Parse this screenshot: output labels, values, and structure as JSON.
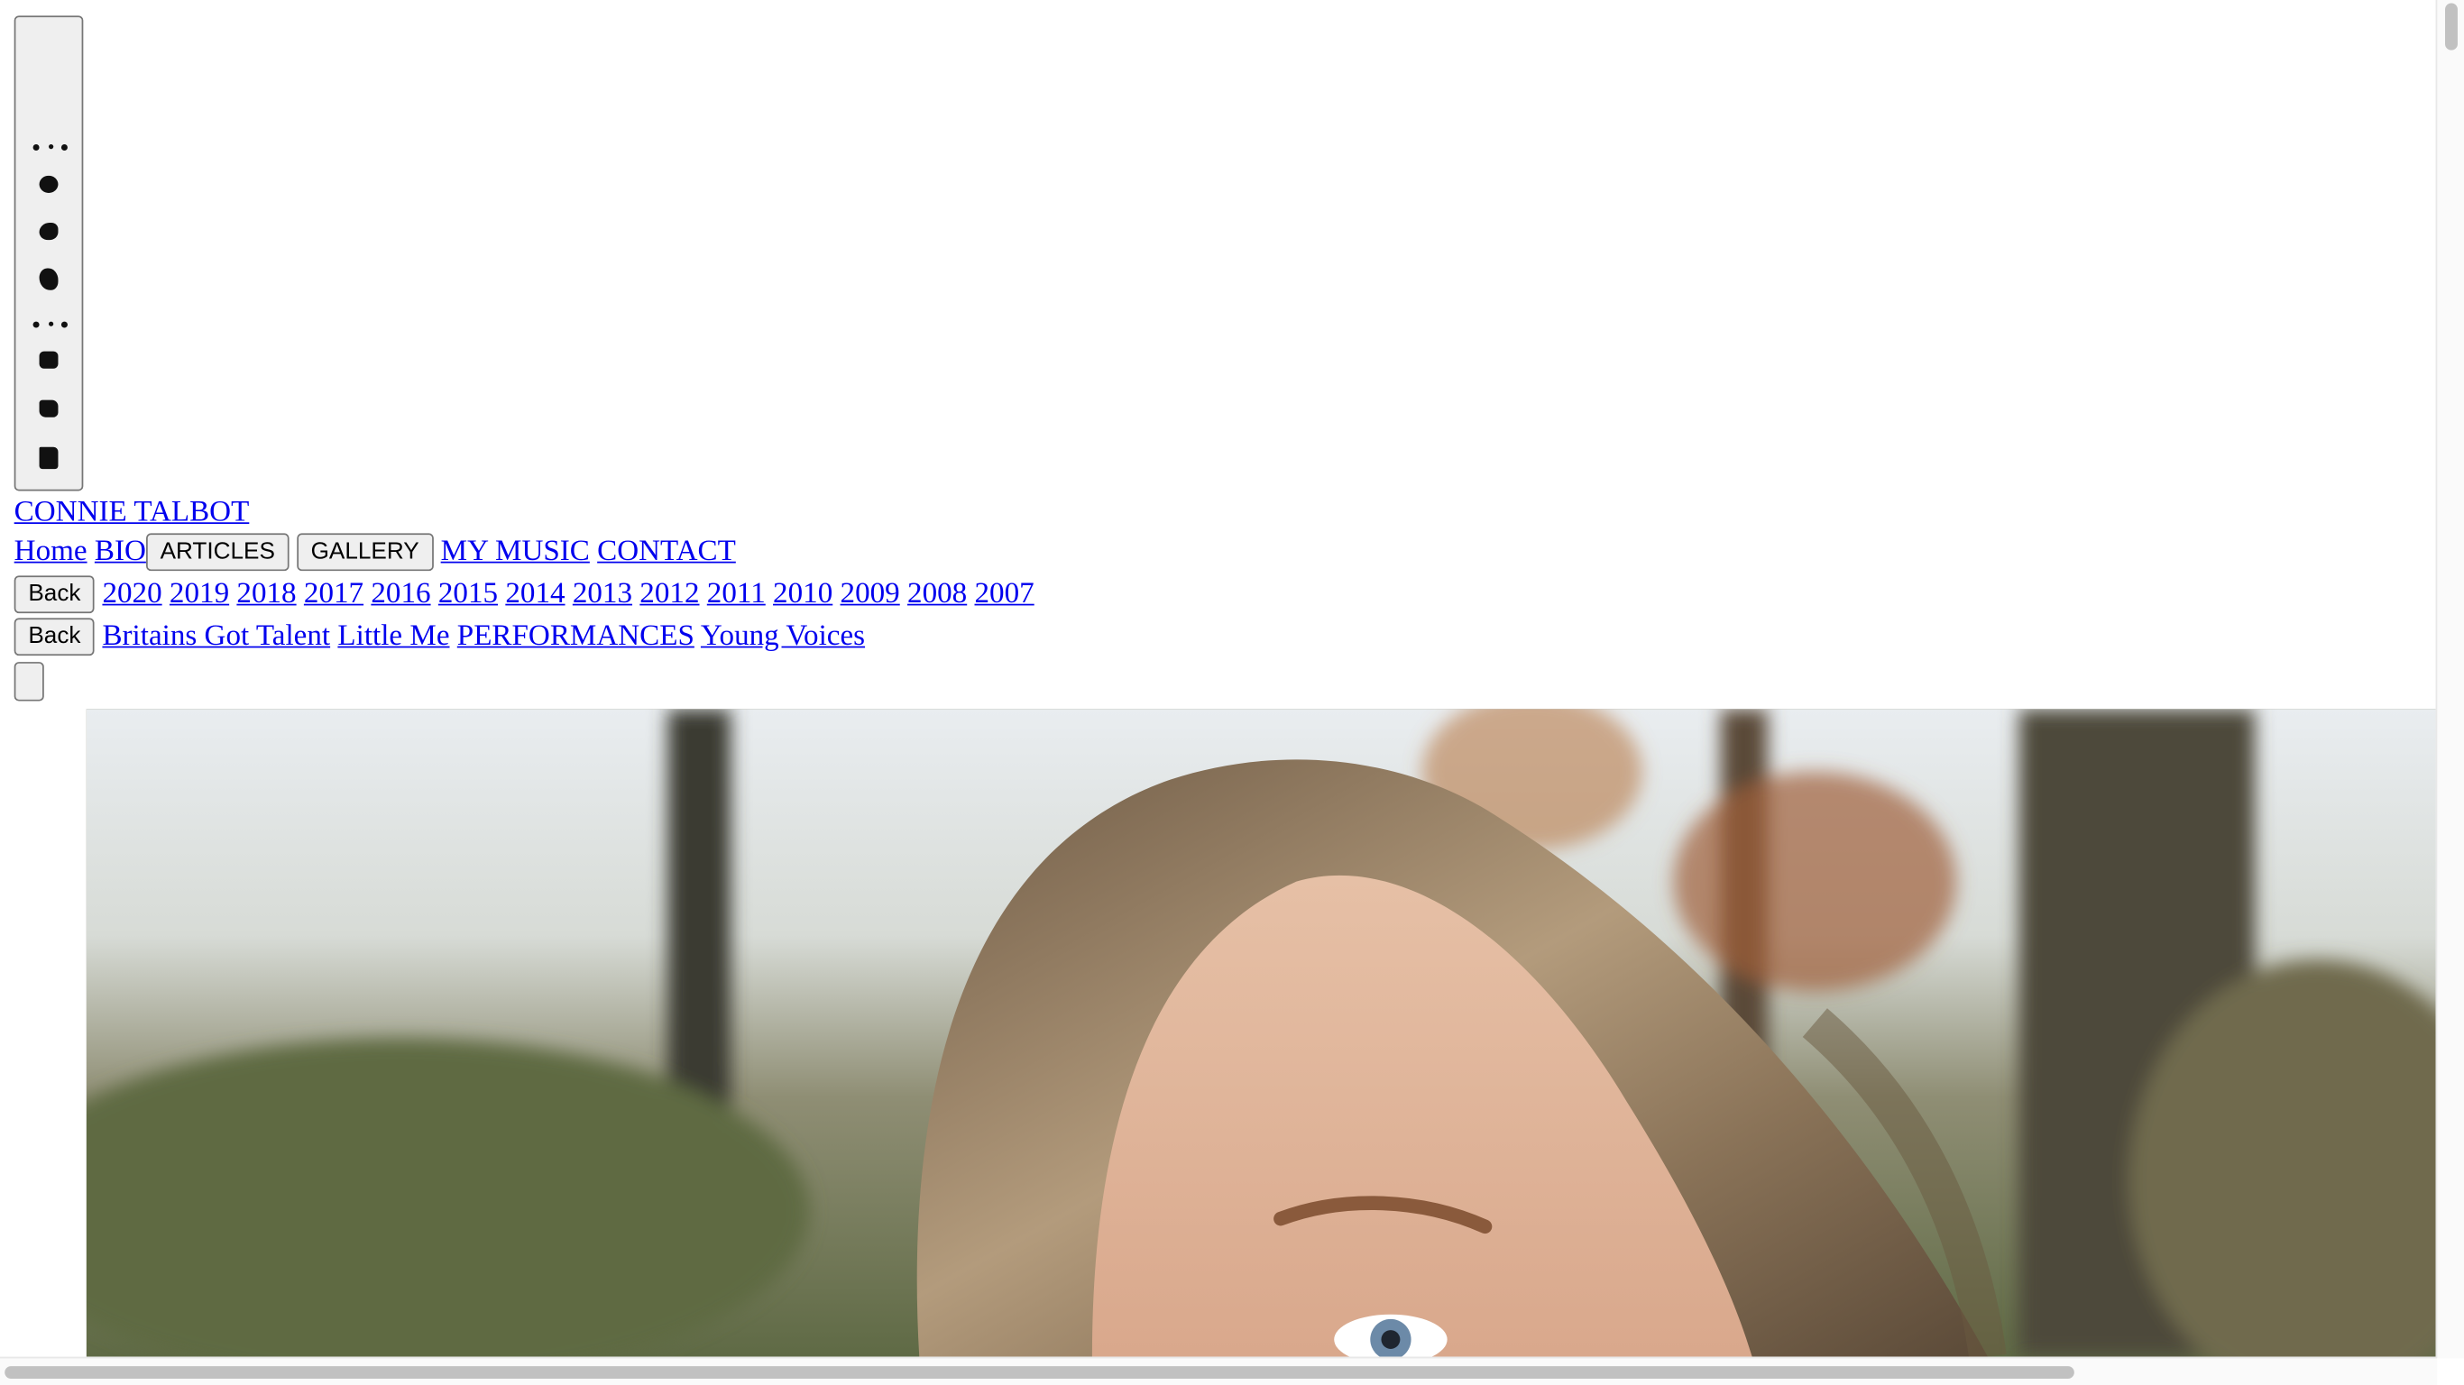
{
  "site": {
    "brand": "CONNIE TALBOT"
  },
  "nav": {
    "home": "Home",
    "bio": "BIO",
    "articles": "ARTICLES",
    "gallery": "GALLERY",
    "music": "MY MUSIC",
    "contact": "CONTACT"
  },
  "articles_submenu": {
    "back": "Back",
    "years": [
      "2020",
      "2019",
      "2018",
      "2017",
      "2016",
      "2015",
      "2014",
      "2013",
      "2012",
      "2011",
      "2010",
      "2009",
      "2008",
      "2007"
    ]
  },
  "gallery_submenu": {
    "back": "Back",
    "items": [
      "Britains Got Talent",
      "Little Me",
      "PERFORMANCES",
      "Young Voices"
    ]
  },
  "hero": {
    "alt": "portrait photo"
  },
  "icons": {
    "menu_toggle": "hamburger-glyphs-icon"
  }
}
